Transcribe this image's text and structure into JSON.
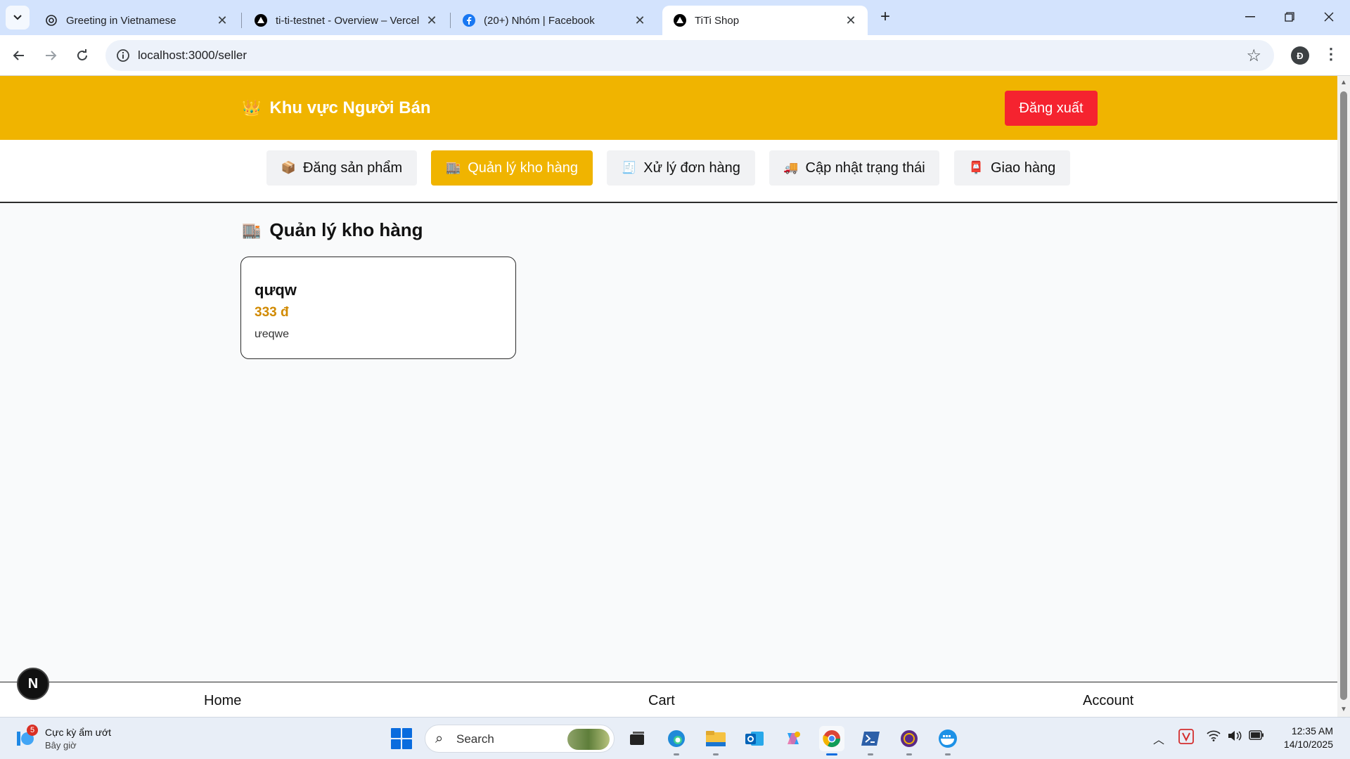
{
  "browser": {
    "tabs": [
      {
        "title": "Greeting in Vietnamese",
        "icon": "openai-icon"
      },
      {
        "title": "ti-ti-testnet - Overview – Vercel",
        "icon": "vercel-icon"
      },
      {
        "title": "(20+) Nhóm | Facebook",
        "icon": "facebook-icon"
      },
      {
        "title": "TiTi Shop",
        "icon": "vercel-icon",
        "active": true
      }
    ],
    "url": "localhost:3000/seller",
    "profile_initial": "Đ"
  },
  "page": {
    "header": {
      "icon": "👑",
      "title": "Khu vực Người Bán",
      "logout_label": "Đăng xuất"
    },
    "nav": [
      {
        "icon": "📦",
        "label": "Đăng sản phẩm"
      },
      {
        "icon": "🏬",
        "label": "Quản lý kho hàng",
        "active": true
      },
      {
        "icon": "🧾",
        "label": "Xử lý đơn hàng"
      },
      {
        "icon": "🚚",
        "label": "Cập nhật trạng thái"
      },
      {
        "icon": "📮",
        "label": "Giao hàng"
      }
    ],
    "section": {
      "icon": "🏬",
      "title": "Quản lý kho hàng"
    },
    "products": [
      {
        "name": "qưqw",
        "price": "333 đ",
        "description": "ưeqwe"
      }
    ],
    "bottom_nav": {
      "home": "Home",
      "cart": "Cart",
      "account": "Account"
    },
    "dev_badge": "N"
  },
  "taskbar": {
    "weather": {
      "title": "Cực kỳ ẩm ướt",
      "subtitle": "Bây giờ",
      "badge": "5"
    },
    "search_placeholder": "Search",
    "time": "12:35 AM",
    "date": "14/10/2025"
  },
  "colors": {
    "brand_yellow": "#f0b400",
    "logout_red": "#f5232f",
    "price_orange": "#d18a00"
  }
}
